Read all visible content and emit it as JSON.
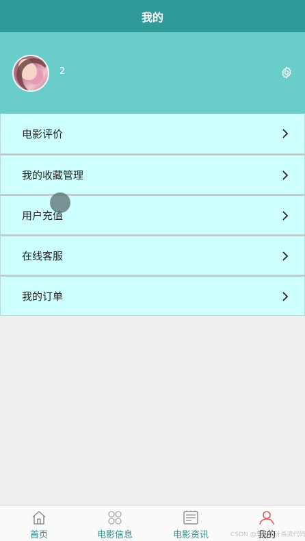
{
  "header": {
    "title": "我的"
  },
  "profile": {
    "username": "2",
    "settings_icon": "gear-icon"
  },
  "menu": {
    "items": [
      {
        "label": "电影评价"
      },
      {
        "label": "我的收藏管理"
      },
      {
        "label": "用户充值"
      },
      {
        "label": "在线客服"
      },
      {
        "label": "我的订单"
      }
    ]
  },
  "tabbar": {
    "items": [
      {
        "label": "首页",
        "icon": "home-icon"
      },
      {
        "label": "电影信息",
        "icon": "grid-icon"
      },
      {
        "label": "电影资讯",
        "icon": "news-icon"
      },
      {
        "label": "我的",
        "icon": "user-icon"
      }
    ],
    "active_index": 3
  },
  "watermark": "CSDN @毕业设计杀流代码",
  "colors": {
    "titlebar": "#2f9a98",
    "profile_bg": "#69cdca",
    "menu_bg": "#cdfffe",
    "tab_label": "#2d8e8c",
    "active_icon": "#e85a5a"
  }
}
